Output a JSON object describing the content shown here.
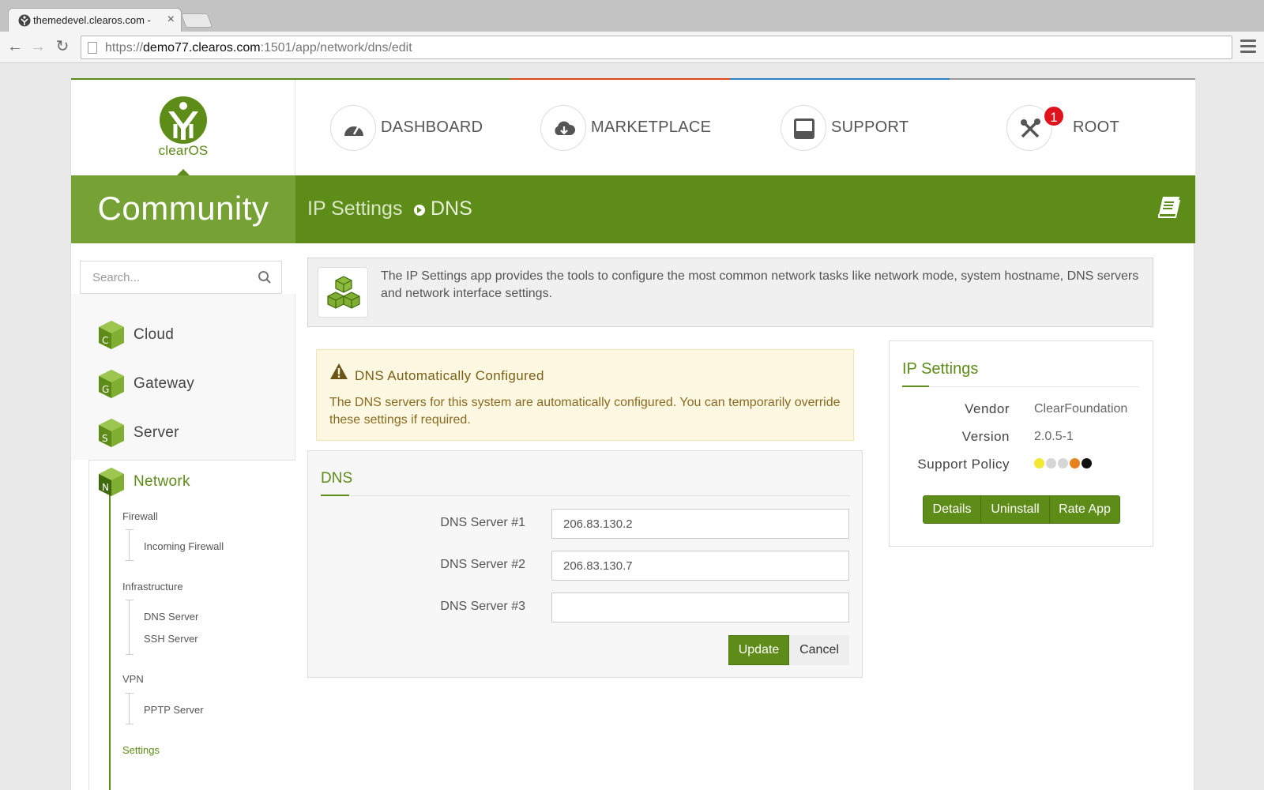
{
  "browser": {
    "tab_title": "themedevel.clearos.com -",
    "url_scheme": "https://",
    "url_host": "demo77.clearos.com",
    "url_rest": ":1501/app/network/dns/edit"
  },
  "header": {
    "logo_text": "clearOS",
    "nav": [
      {
        "label": "DASHBOARD"
      },
      {
        "label": "MARKETPLACE"
      },
      {
        "label": "SUPPORT"
      },
      {
        "label": "ROOT",
        "badge": "1"
      }
    ],
    "accent_colors": [
      "#5e8c18",
      "#d94a1f",
      "#2f7fc8",
      "#9a9a9a"
    ]
  },
  "banner": {
    "brand": "Community",
    "crumb_parent": "IP Settings",
    "crumb_current": "DNS"
  },
  "sidebar": {
    "search_placeholder": "Search...",
    "categories": [
      {
        "label": "Cloud",
        "letter": "C"
      },
      {
        "label": "Gateway",
        "letter": "G"
      },
      {
        "label": "Server",
        "letter": "S"
      },
      {
        "label": "Network",
        "letter": "N"
      }
    ],
    "network_tree": {
      "firewall": {
        "label": "Firewall",
        "items": [
          "Incoming Firewall"
        ]
      },
      "infrastructure": {
        "label": "Infrastructure",
        "items": [
          "DNS Server",
          "SSH Server"
        ]
      },
      "vpn": {
        "label": "VPN",
        "items": [
          "PPTP Server"
        ]
      },
      "settings": {
        "label": "Settings"
      }
    }
  },
  "main": {
    "info_text": "The IP Settings app provides the tools to configure the most common network tasks like network mode, system hostname, DNS servers and network interface settings.",
    "warning": {
      "title": "DNS Automatically Configured",
      "text": "The DNS servers for this system are automatically configured. You can temporarily override these settings if required."
    },
    "form": {
      "title": "DNS",
      "fields": [
        {
          "label": "DNS Server #1",
          "value": "206.83.130.2"
        },
        {
          "label": "DNS Server #2",
          "value": "206.83.130.7"
        },
        {
          "label": "DNS Server #3",
          "value": ""
        }
      ],
      "update_label": "Update",
      "cancel_label": "Cancel"
    }
  },
  "app_card": {
    "title": "IP Settings",
    "vendor_key": "Vendor",
    "vendor_val": "ClearFoundation",
    "version_key": "Version",
    "version_val": "2.0.5-1",
    "support_key": "Support Policy",
    "support_dots": [
      "#f2e832",
      "#d6d6d6",
      "#d6d6d6",
      "#e8821e",
      "#111111"
    ],
    "buttons": {
      "details": "Details",
      "uninstall": "Uninstall",
      "rate": "Rate App"
    }
  }
}
